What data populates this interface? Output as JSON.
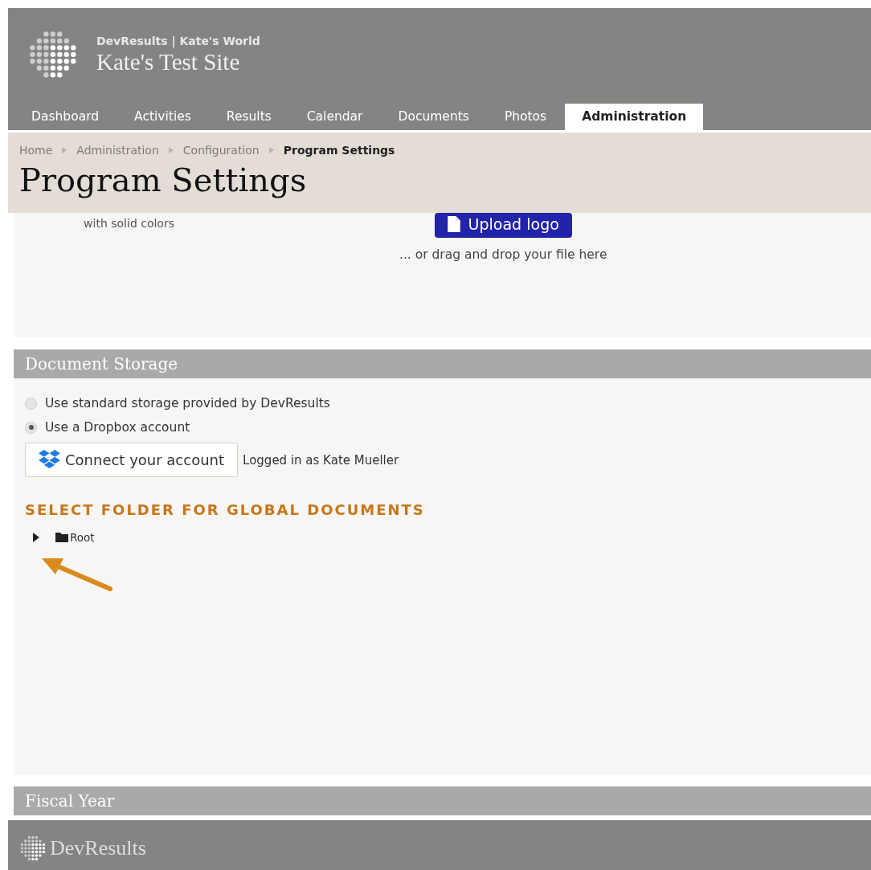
{
  "header": {
    "org": "DevResults | Kate's World",
    "site": "Kate's Test Site"
  },
  "tabs": [
    {
      "label": "Dashboard",
      "selected": false
    },
    {
      "label": "Activities",
      "selected": false
    },
    {
      "label": "Results",
      "selected": false
    },
    {
      "label": "Calendar",
      "selected": false
    },
    {
      "label": "Documents",
      "selected": false
    },
    {
      "label": "Photos",
      "selected": false
    },
    {
      "label": "Administration",
      "selected": true
    }
  ],
  "breadcrumb": [
    {
      "label": "Home",
      "current": false
    },
    {
      "label": "Administration",
      "current": false
    },
    {
      "label": "Configuration",
      "current": false
    },
    {
      "label": "Program Settings",
      "current": true
    }
  ],
  "page_title": "Program Settings",
  "logo_section": {
    "hint": "with solid colors",
    "upload_button": "Upload logo",
    "drop_hint": "... or drag and drop your file here"
  },
  "document_storage": {
    "title": "Document Storage",
    "options": [
      {
        "label": "Use standard storage provided by DevResults",
        "selected": false
      },
      {
        "label": "Use a Dropbox account",
        "selected": true
      }
    ],
    "connect_button": "Connect your account",
    "login_status": "Logged in as Kate Mueller",
    "folder_heading": "SELECT FOLDER FOR GLOBAL DOCUMENTS",
    "tree": [
      {
        "label": "Root",
        "expanded": false
      }
    ]
  },
  "fiscal_year": {
    "title": "Fiscal Year"
  },
  "footer": {
    "logo_text": "DevResults"
  }
}
